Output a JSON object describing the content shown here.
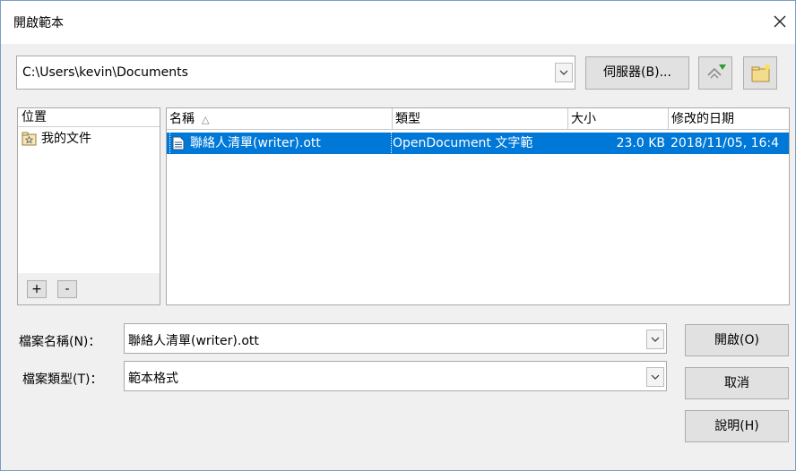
{
  "window": {
    "title": "開啟範本"
  },
  "path_bar": {
    "value": "C:\\Users\\kevin\\Documents",
    "server_button": "伺服器(B)..."
  },
  "places": {
    "header": "位置",
    "items": [
      {
        "label": "我的文件",
        "icon": "star-folder-icon"
      }
    ],
    "add_label": "+",
    "remove_label": "-"
  },
  "file_list": {
    "columns": [
      {
        "label": "名稱",
        "sort": "ascending"
      },
      {
        "label": "類型"
      },
      {
        "label": "大小"
      },
      {
        "label": "修改的日期"
      }
    ],
    "sort_indicator": "△",
    "rows": [
      {
        "name": "聯絡人清單(writer).ott",
        "type": "OpenDocument 文字範",
        "size": "23.0 KB",
        "date": "2018/11/05, 16:4",
        "selected": true
      }
    ]
  },
  "form": {
    "filename_label": "檔案名稱(N)：",
    "filename_value": "聯絡人清單(writer).ott",
    "filetype_label": "檔案類型(T)：",
    "filetype_value": "範本格式"
  },
  "buttons": {
    "open": "開啟(O)",
    "cancel": "取消",
    "help": "說明(H)"
  },
  "colors": {
    "selection": "#0078d7",
    "button_face": "#e1e1e1",
    "dialog_bg": "#f0f0f0"
  }
}
